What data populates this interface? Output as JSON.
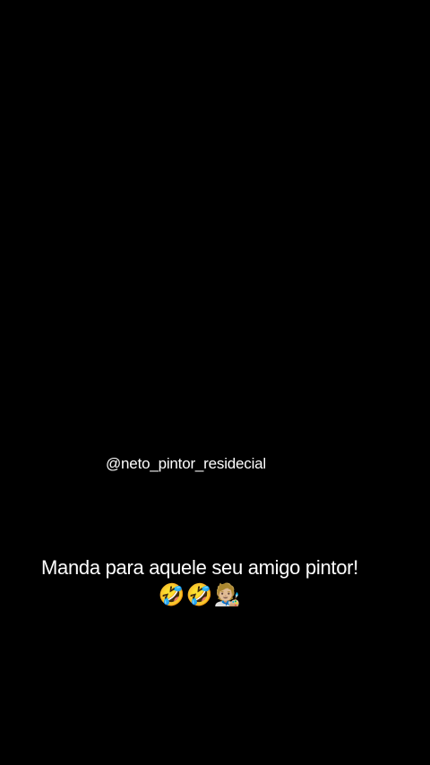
{
  "overlay": {
    "handle": "@neto_pintor_residecial",
    "caption": "Manda para aquele seu amigo pintor!",
    "emojis": "🤣🤣🧑🏼‍🎨"
  }
}
